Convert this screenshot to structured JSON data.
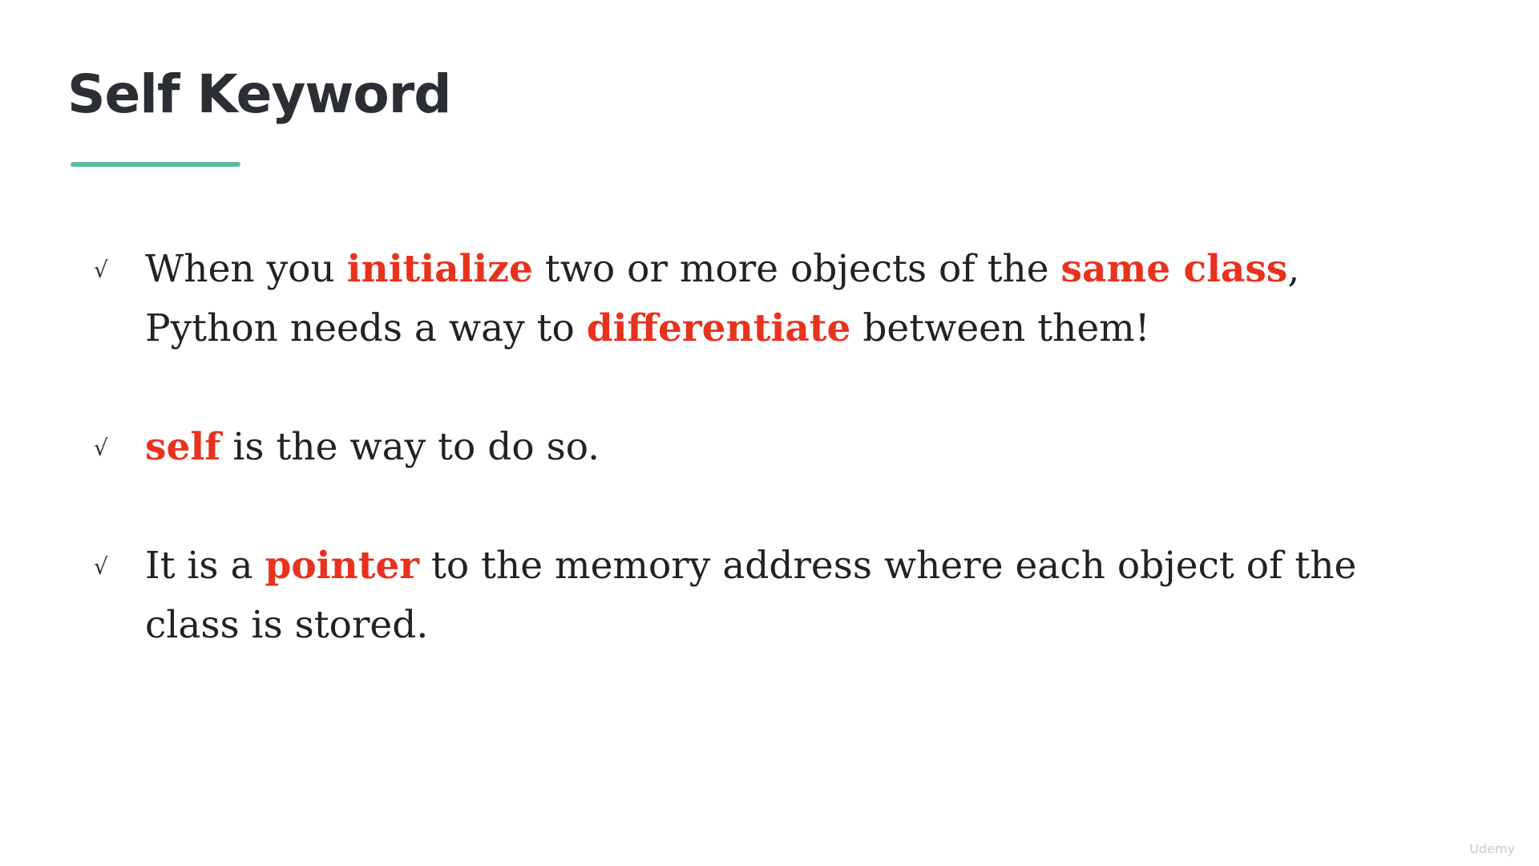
{
  "slide": {
    "title": "Self Keyword",
    "accent_color": "#5cbf98",
    "highlight_color": "#e8321e",
    "bullet_glyph": "√",
    "bullet_icon": "check-icon"
  },
  "bullets": [
    {
      "segments": [
        {
          "text": "When you ",
          "highlight": false
        },
        {
          "text": "initialize",
          "highlight": true
        },
        {
          "text": " two or more objects of the ",
          "highlight": false
        },
        {
          "text": "same class",
          "highlight": true
        },
        {
          "text": ", Python needs a way to ",
          "highlight": false
        },
        {
          "text": "differentiate",
          "highlight": true
        },
        {
          "text": " between them!",
          "highlight": false
        }
      ]
    },
    {
      "segments": [
        {
          "text": "self",
          "highlight": true
        },
        {
          "text": " is the way to do so.",
          "highlight": false
        }
      ]
    },
    {
      "segments": [
        {
          "text": "It is a ",
          "highlight": false
        },
        {
          "text": "pointer",
          "highlight": true
        },
        {
          "text": " to the memory address where each object of the class is stored.",
          "highlight": false
        }
      ]
    }
  ],
  "watermark": {
    "text": "Udemy"
  }
}
